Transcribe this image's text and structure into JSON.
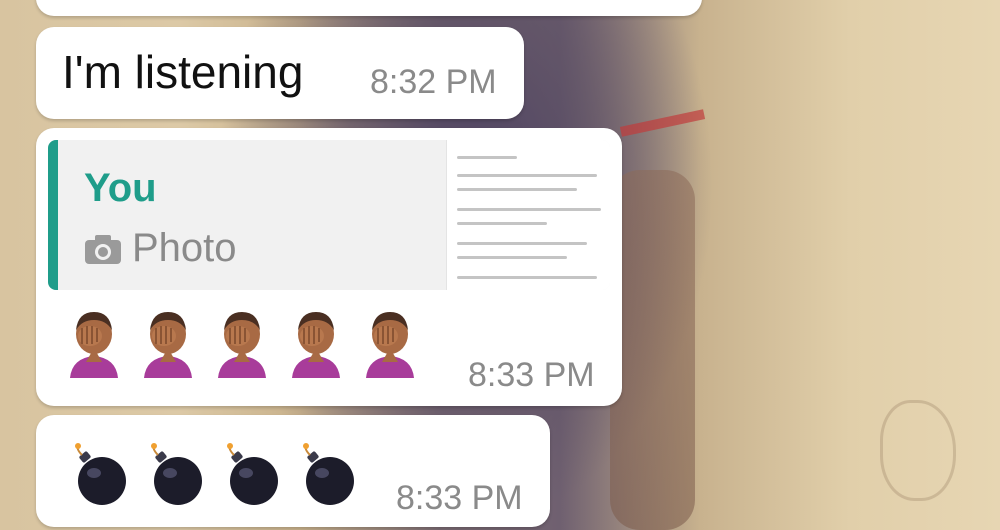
{
  "chat": {
    "messages": [
      {
        "text": "I'm listening",
        "time": "8:32 PM"
      },
      {
        "quote": {
          "author": "You",
          "type_label": "Photo",
          "type_icon": "camera-icon"
        },
        "emoji": [
          "facepalm",
          "facepalm",
          "facepalm",
          "facepalm",
          "facepalm"
        ],
        "time": "8:33 PM"
      },
      {
        "emoji": [
          "bomb",
          "bomb",
          "bomb",
          "bomb"
        ],
        "time": "8:33 PM"
      }
    ]
  },
  "colors": {
    "bubble": "#ffffff",
    "quote_accent": "#1f9d8a",
    "timestamp": "#8a8a8a",
    "quote_background": "#f1f1f1"
  }
}
